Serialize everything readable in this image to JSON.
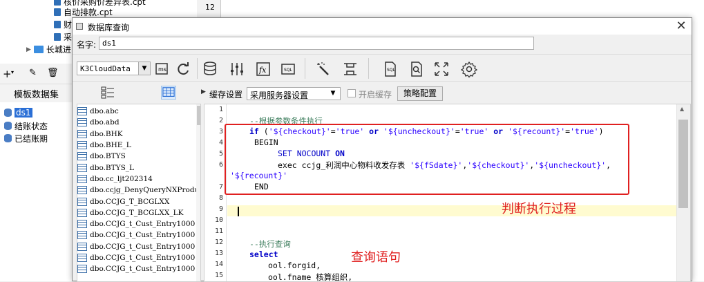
{
  "background": {
    "files": [
      "核价采购价差异表.cpt",
      "自动排款.cpt",
      "财",
      "采"
    ],
    "folder": "长城进",
    "sheet_row": "12",
    "dataset_label": "模板数据集",
    "datasets": [
      "ds1",
      "结账状态",
      "已结账期"
    ]
  },
  "dialog": {
    "title": "数据库查询",
    "close": "✕",
    "name_label": "名字:",
    "name_value": "ds1",
    "connection": "K3CloudData",
    "cache_label": "缓存设置",
    "cache_value": "采用服务器设置",
    "enable_cache": "开启缓存",
    "policy_button": "策略配置"
  },
  "toolbar_icons": [
    "new-query-icon",
    "refresh-icon",
    "database-sql-icon",
    "parameters-icon",
    "formula-icon",
    "sql-icon",
    "magic-wand-icon",
    "expand-icon",
    "sql-page-icon",
    "preview-icon",
    "fullscreen-icon",
    "settings-icon"
  ],
  "tables": [
    "dbo.abc",
    "dbo.abd",
    "dbo.BHK",
    "dbo.BHE_L",
    "dbo.BTYS",
    "dbo.BTYS_L",
    "dbo.cc_ljt202314",
    "dbo.ccjg_DenyQueryNXProdu",
    "dbo.CCJG_T_BCGLXX",
    "dbo.CCJG_T_BCGLXX_LK",
    "dbo.CCJG_t_Cust_Entry1000",
    "dbo.CCJG_t_Cust_Entry1000",
    "dbo.CCJG_t_Cust_Entry1000",
    "dbo.CCJG_t_Cust_Entry1000",
    "dbo.CCJG_t_Cust_Entry1000"
  ],
  "editor": {
    "line_numbers": [
      "1",
      "2",
      "3",
      "4",
      "5",
      "6",
      "",
      "7",
      "8",
      "9",
      "10",
      "11",
      "12",
      "13",
      "14",
      "15"
    ],
    "lines": {
      "l2": "--根据参数条件执行",
      "l5": "SET NOCOUNT ON",
      "l4": "BEGIN",
      "l7": "END",
      "l11": "--执行查询",
      "l12": "select",
      "l13": "ool.forgid,",
      "l14": "ool.fname 核算组织,"
    }
  },
  "annotations": {
    "judge": "判断执行过程",
    "query": "查询语句"
  },
  "colors": {
    "annotation": "#e02020",
    "keyword": "#0000c8",
    "string": "#2a00ff",
    "comment": "#3f7f5f"
  }
}
